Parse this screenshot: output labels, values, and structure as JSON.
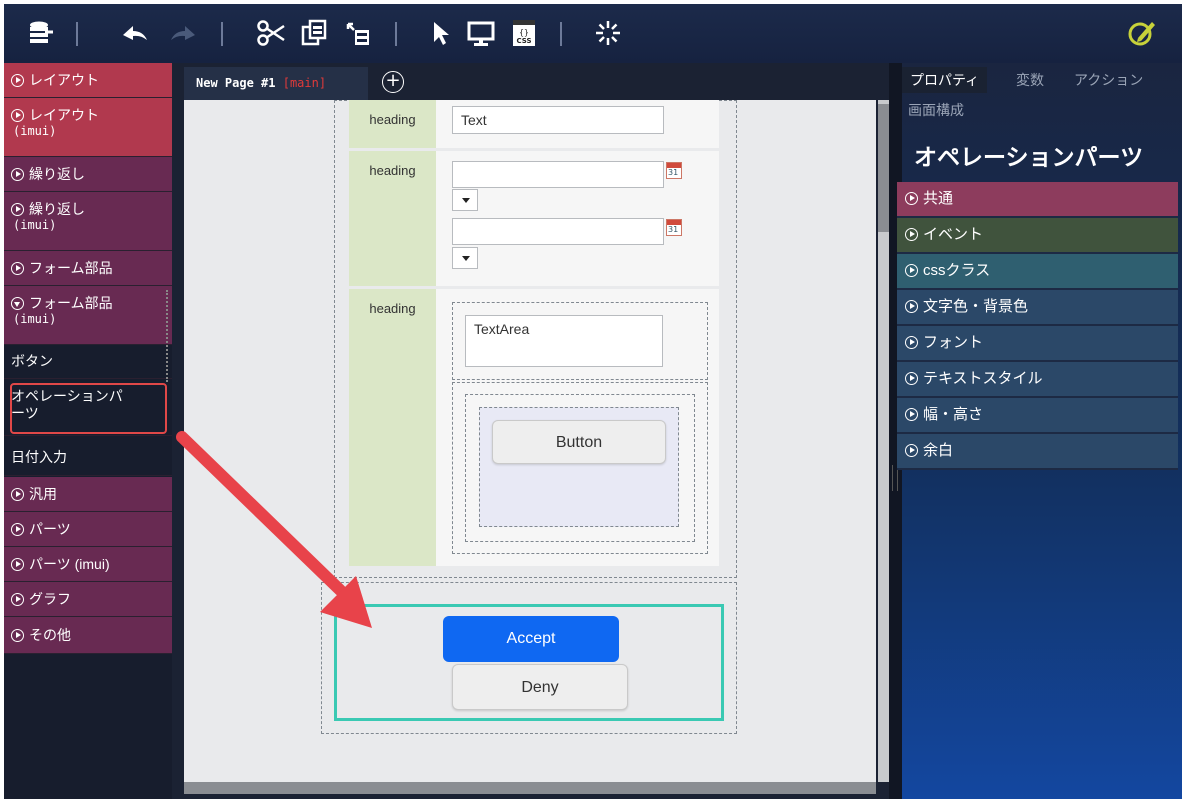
{
  "toolbar": {
    "icons": [
      "database-icon",
      "undo-icon",
      "redo-icon",
      "cut-icon",
      "copy-icon",
      "move-icon",
      "select-icon",
      "preview-icon",
      "css-icon",
      "loading-icon",
      "edit-icon"
    ],
    "css_label": "{}CSS"
  },
  "left_panel": {
    "items": [
      {
        "label": "レイアウト",
        "sub": "",
        "style": "red",
        "icon": "circle-play-icon"
      },
      {
        "label": "レイアウト",
        "sub": "(imui)",
        "style": "red",
        "icon": "circle-play-icon"
      },
      {
        "label": "繰り返し",
        "sub": "",
        "style": "plum",
        "icon": "circle-play-icon"
      },
      {
        "label": "繰り返し",
        "sub": "(imui)",
        "style": "plum",
        "icon": "circle-play-icon"
      },
      {
        "label": "フォーム部品",
        "sub": "",
        "style": "plum",
        "icon": "circle-play-icon"
      },
      {
        "label": "フォーム部品",
        "sub": "(imui)",
        "style": "plum",
        "icon": "circle-down-icon"
      },
      {
        "label": "ボタン",
        "sub": "",
        "style": "dark",
        "icon": ""
      },
      {
        "label": "オペレーションパ",
        "sub": "ーツ",
        "style": "dark",
        "icon": ""
      },
      {
        "label": "日付入力",
        "sub": "",
        "style": "dark",
        "icon": ""
      },
      {
        "label": "汎用",
        "sub": "",
        "style": "plum",
        "icon": "circle-play-icon"
      },
      {
        "label": "パーツ",
        "sub": "",
        "style": "plum",
        "icon": "circle-play-icon"
      },
      {
        "label": "パーツ (imui)",
        "sub": "",
        "style": "plum",
        "icon": "circle-play-icon"
      },
      {
        "label": "グラフ",
        "sub": "",
        "style": "plum",
        "icon": "circle-play-icon"
      },
      {
        "label": "その他",
        "sub": "",
        "style": "plum",
        "icon": "circle-play-icon"
      }
    ]
  },
  "editor": {
    "tab": {
      "name": "New Page #1",
      "tag": "[main]"
    },
    "rows": [
      {
        "heading": "heading",
        "value": "Text"
      },
      {
        "heading": "heading"
      },
      {
        "heading": "heading",
        "textarea": "TextArea",
        "button": "Button"
      }
    ],
    "calendar_day": "31",
    "accept_label": "Accept",
    "deny_label": "Deny"
  },
  "right_panel": {
    "tabs": [
      "プロパティ",
      "変数",
      "アクション"
    ],
    "active_tab": "プロパティ",
    "subtitle": "画面構成",
    "title": "オペレーションパーツ",
    "sections": [
      "共通",
      "イベント",
      "cssクラス",
      "文字色・背景色",
      "フォント",
      "テキストスタイル",
      "幅・高さ",
      "余白"
    ],
    "section_colors": [
      "#8d3c5d",
      "#40533d",
      "#2f5f70",
      "#2b4868"
    ]
  },
  "annotation": {
    "arrow_color": "#e8434a",
    "highlight_color": "#3ac9b3"
  }
}
